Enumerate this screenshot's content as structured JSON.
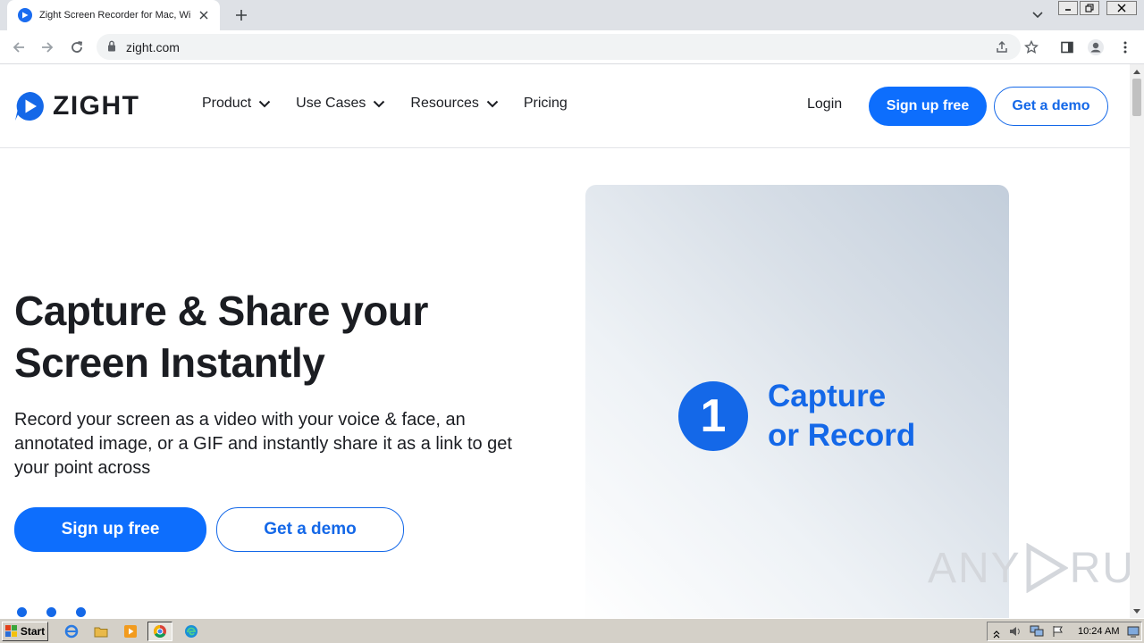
{
  "browser": {
    "tab_title": "Zight Screen Recorder for Mac, Windows",
    "url": "zight.com"
  },
  "header": {
    "logo_text": "ZIGHT",
    "nav": [
      {
        "label": "Product"
      },
      {
        "label": "Use Cases"
      },
      {
        "label": "Resources"
      },
      {
        "label": "Pricing"
      }
    ],
    "login_label": "Login",
    "signup_label": "Sign up free",
    "demo_label": "Get a demo"
  },
  "hero": {
    "title_line1": "Capture & Share your",
    "title_line2": "Screen Instantly",
    "subtitle": "Record your screen as a video with your voice & face, an annotated image, or a GIF and instantly share it as a link to get your point across",
    "signup_label": "Sign up free",
    "demo_label": "Get a demo",
    "step_number": "1",
    "step_line1": "Capture",
    "step_line2": "or Record"
  },
  "watermark": {
    "left": "ANY",
    "right": "RUN"
  },
  "taskbar": {
    "start_label": "Start",
    "clock": "10:24 AM"
  },
  "colors": {
    "brand_blue": "#0d6efd",
    "accent_blue": "#1468e8"
  }
}
